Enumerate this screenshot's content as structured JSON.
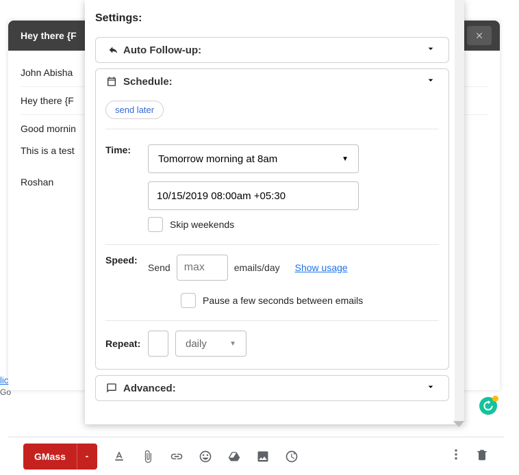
{
  "compose": {
    "title": "Hey there {F",
    "close_icon": "close",
    "to_name": "John Abisha",
    "subject": "Hey there {F",
    "body_line1": "Good mornin",
    "body_line2": "This is a test",
    "signature": "Roshan"
  },
  "panel": {
    "title": "Settings:",
    "sections": {
      "auto": {
        "header": "Auto Follow-up:"
      },
      "schedule": {
        "header": "Schedule:",
        "send_later_pill": "send later",
        "time": {
          "label": "Time:",
          "preset": "Tomorrow morning at 8am",
          "datetime": "10/15/2019 08:00am +05:30",
          "skip_weekends": "Skip weekends"
        },
        "speed": {
          "label": "Speed:",
          "send_text": "Send",
          "max_placeholder": "max",
          "per_day_text": "emails/day",
          "show_usage": "Show usage",
          "pause_text": "Pause a few seconds between emails"
        },
        "repeat": {
          "label": "Repeat:",
          "freq": "daily"
        }
      },
      "advanced": {
        "header": "Advanced:"
      }
    }
  },
  "toolbar": {
    "gmass": "GMass"
  },
  "misc": {
    "leftclip": "lic",
    "leftclip2": "Go"
  }
}
